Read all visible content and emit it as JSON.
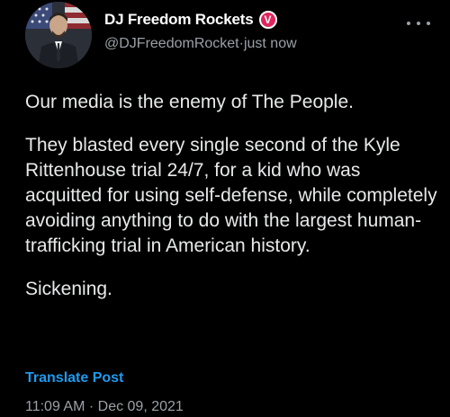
{
  "author": {
    "display_name": "DJ Freedom Rockets",
    "verified_badge": "V",
    "handle": "@DJFreedomRocket",
    "separator": " · ",
    "time_ago": "just now",
    "avatar_icon": "profile-photo-icon"
  },
  "tweet": {
    "paragraphs": [
      "Our media is the enemy of The People.",
      "They blasted every single second of the Kyle Rittenhouse trial 24/7, for a kid who was acquitted for using self-defense, while completely avoiding anything to do with the largest human-trafficking trial in American history.",
      "Sickening."
    ],
    "translate_label": "Translate Post",
    "timestamp": "11:09 AM · Dec 09, 2021"
  },
  "colors": {
    "background": "#000000",
    "text": "#e7e9ea",
    "muted": "#9aa0a6",
    "link": "#1d9bf0",
    "badge": "#e0245e"
  }
}
